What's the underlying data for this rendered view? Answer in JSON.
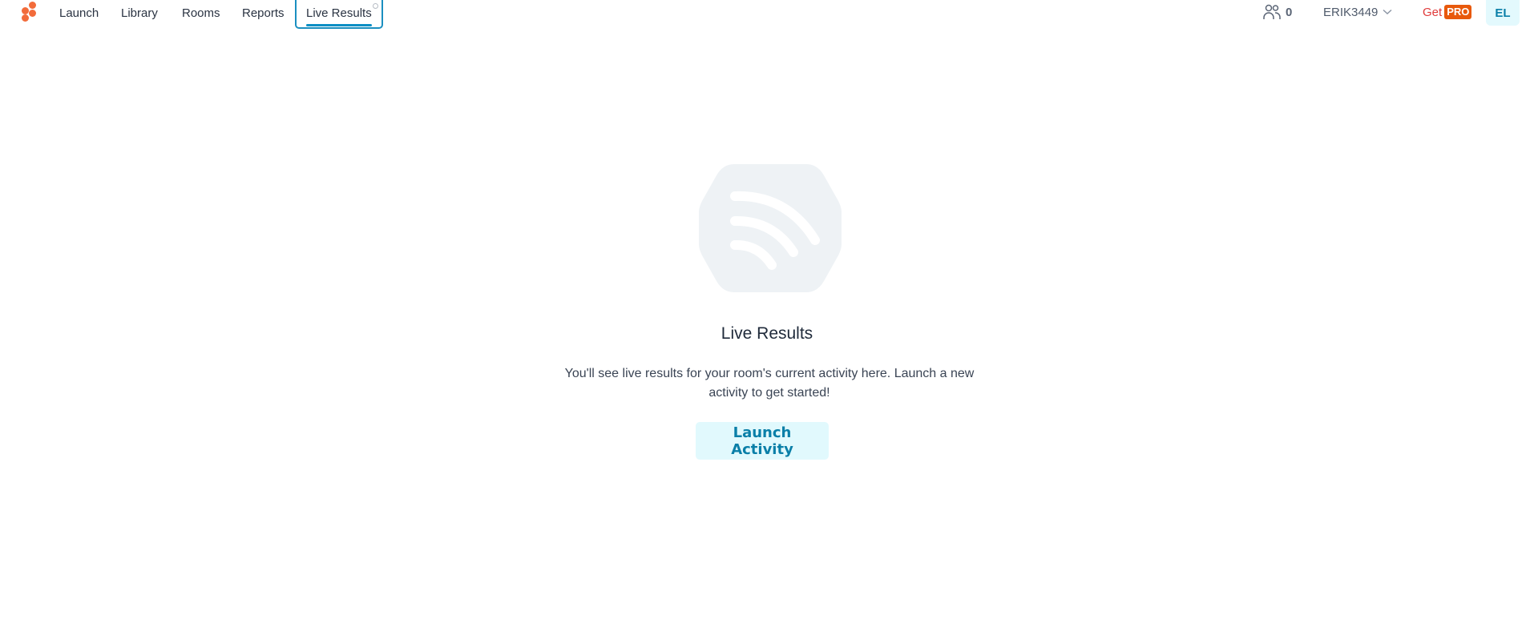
{
  "nav": {
    "logo": "logo-dots",
    "items": [
      {
        "label": "Launch"
      },
      {
        "label": "Library"
      },
      {
        "label": "Rooms"
      },
      {
        "label": "Reports"
      },
      {
        "label": "Live Results",
        "active": true
      }
    ]
  },
  "header_right": {
    "participants_icon": "users-icon",
    "participants_count": "0",
    "room_name": "ERIK3449",
    "get_label": "Get",
    "pro_label": "PRO",
    "avatar_initials": "EL"
  },
  "empty_state": {
    "icon": "live-results-broadcast-icon",
    "title": "Live Results",
    "description": "You'll see live results for your room's current activity here. Launch a new activity to get started!",
    "button_label": "Launch Activity"
  },
  "colors": {
    "brand_orange": "#f26b3a",
    "accent_blue": "#0b8ec4",
    "button_bg": "#e1f9fd",
    "button_text": "#0a7fa8",
    "pro_badge": "#e8590c",
    "get_red": "#e03a3a"
  }
}
